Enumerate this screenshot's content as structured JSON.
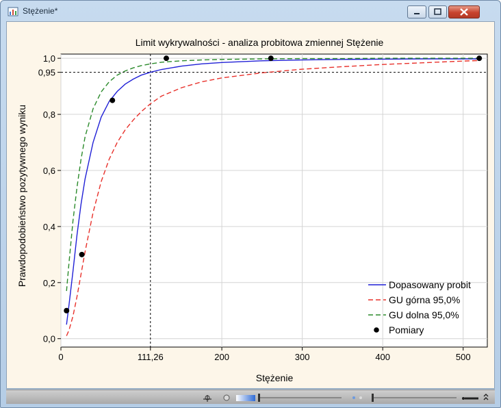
{
  "window": {
    "title": "Stężenie*",
    "controls": [
      "minimize",
      "maximize",
      "close"
    ]
  },
  "chart_data": {
    "type": "line",
    "title": "Limit wykrywalności - analiza probitowa zmiennej Stężenie",
    "xlabel": "Stężenie",
    "ylabel": "Prawdopodobieństwo pozytywnego wyniku",
    "xlim": [
      0,
      530
    ],
    "ylim": [
      -0.03,
      1.015
    ],
    "xticks": [
      0,
      111.26,
      200,
      300,
      400,
      500
    ],
    "xtick_labels": [
      "0",
      "111,26",
      "200",
      "300",
      "400",
      "500"
    ],
    "yticks": [
      0.0,
      0.2,
      0.4,
      0.6,
      0.8,
      0.95,
      1.0
    ],
    "ytick_labels": [
      "0,0",
      "0,2",
      "0,4",
      "0,6",
      "0,8",
      "0,95",
      "1,0"
    ],
    "grid": true,
    "legend_position": "bottom-right",
    "reference_lines": {
      "x": 111.26,
      "y": 0.95
    },
    "series": [
      {
        "name": "Dopasowany probit",
        "style": "solid",
        "color": "#1f1fd6",
        "x": [
          7,
          10,
          15,
          20,
          25,
          30,
          40,
          50,
          60,
          70,
          80,
          90,
          100,
          111.26,
          125,
          150,
          175,
          200,
          250,
          300,
          350,
          400,
          450,
          500,
          520
        ],
        "y": [
          0.05,
          0.12,
          0.24,
          0.37,
          0.48,
          0.57,
          0.7,
          0.79,
          0.846,
          0.882,
          0.908,
          0.926,
          0.94,
          0.95,
          0.96,
          0.972,
          0.98,
          0.985,
          0.991,
          0.994,
          0.996,
          0.997,
          0.998,
          0.998,
          0.998
        ]
      },
      {
        "name": "GU górna 95,0%",
        "style": "dashed",
        "color": "#e8302a",
        "x": [
          7,
          10,
          15,
          20,
          25,
          30,
          40,
          50,
          60,
          70,
          80,
          90,
          100,
          111.26,
          125,
          150,
          175,
          200,
          250,
          300,
          350,
          400,
          450,
          500,
          520
        ],
        "y": [
          0.01,
          0.03,
          0.08,
          0.15,
          0.23,
          0.31,
          0.45,
          0.56,
          0.64,
          0.7,
          0.745,
          0.78,
          0.81,
          0.838,
          0.865,
          0.895,
          0.916,
          0.93,
          0.948,
          0.961,
          0.97,
          0.978,
          0.984,
          0.99,
          0.992
        ]
      },
      {
        "name": "GU dolna 95,0%",
        "style": "dashed",
        "color": "#2a8a2a",
        "x": [
          7,
          10,
          15,
          20,
          25,
          30,
          40,
          50,
          60,
          70,
          80,
          90,
          100,
          111.26,
          125,
          150,
          175,
          200,
          250,
          300,
          350,
          400,
          450,
          500,
          520
        ],
        "y": [
          0.17,
          0.27,
          0.42,
          0.54,
          0.64,
          0.72,
          0.82,
          0.88,
          0.916,
          0.94,
          0.955,
          0.966,
          0.974,
          0.98,
          0.986,
          0.991,
          0.994,
          0.996,
          0.998,
          0.999,
          0.999,
          1.0,
          1.0,
          1.0,
          1.0
        ]
      },
      {
        "name": "Pomiary",
        "style": "points",
        "color": "#000000",
        "x": [
          7,
          26,
          64,
          131,
          261,
          520
        ],
        "y": [
          0.1,
          0.3,
          0.85,
          1.0,
          1.0,
          1.0
        ]
      }
    ]
  }
}
